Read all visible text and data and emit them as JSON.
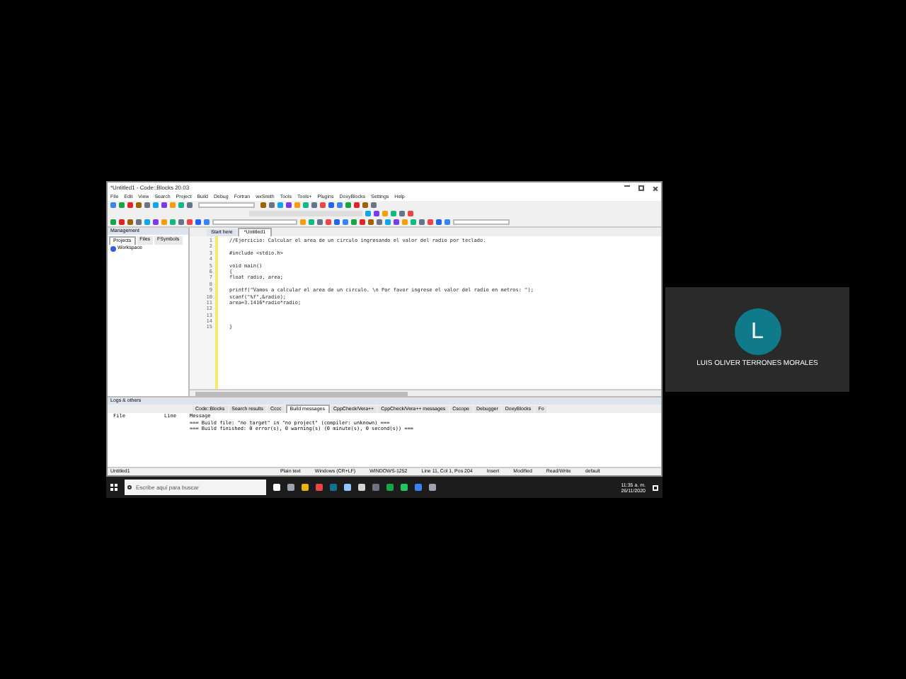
{
  "window": {
    "title": "*Untitled1 - Code::Blocks 20.03"
  },
  "menu": [
    "File",
    "Edit",
    "View",
    "Search",
    "Project",
    "Build",
    "Debug",
    "Fortran",
    "wxSmith",
    "Tools",
    "Tools+",
    "Plugins",
    "DoxyBlocks",
    "Settings",
    "Help"
  ],
  "management": {
    "title": "Management",
    "tabs": [
      {
        "label": "Projects",
        "selected": true
      },
      {
        "label": "Files",
        "selected": false
      },
      {
        "label": "FSymbols",
        "selected": false
      }
    ],
    "items": [
      "Workspace"
    ]
  },
  "editor_tabs": [
    {
      "label": "Start here",
      "selected": false
    },
    {
      "label": "*Untitled1",
      "selected": true
    }
  ],
  "code_lines": [
    {
      "number": "1",
      "text": "//Ejercicio: Calcular el area de un circulo ingresando el valor del radio por teclado."
    },
    {
      "number": "2"
    },
    {
      "number": "3",
      "text": "#include <stdio.h>"
    },
    {
      "number": "4"
    },
    {
      "number": "5",
      "text": "void main()"
    },
    {
      "number": "6",
      "text": "{"
    },
    {
      "number": "7",
      "text": "float radio, area;"
    },
    {
      "number": "8"
    },
    {
      "number": "9",
      "text": "printf(\"Vamos a calcular el area de un circulo. \\n Por favor ingrese el valor del radio en metros: \");"
    },
    {
      "number": "10",
      "text": "scanf(\"%f\",&radio);"
    },
    {
      "number": "11",
      "text": "area=3.1416*radio*radio;"
    },
    {
      "number": "12"
    },
    {
      "number": "13"
    },
    {
      "number": "14"
    },
    {
      "number": "15",
      "text": "}"
    }
  ],
  "logs": {
    "title": "Logs & others",
    "tabs": [
      {
        "label": "Code::Blocks",
        "selected": false
      },
      {
        "label": "Search results",
        "selected": false
      },
      {
        "label": "Cccc",
        "selected": false
      },
      {
        "label": "Build messages",
        "selected": true
      },
      {
        "label": "CppCheck/Vera++",
        "selected": false
      },
      {
        "label": "CppCheck/Vera++ messages",
        "selected": false
      },
      {
        "label": "Cscope",
        "selected": false
      },
      {
        "label": "Debugger",
        "selected": false
      },
      {
        "label": "DoxyBlocks",
        "selected": false
      },
      {
        "label": "Fo",
        "selected": false
      }
    ],
    "columns": [
      "File",
      "Line",
      "Message"
    ],
    "messages": [
      "=== Build file: \"no target\" in \"no project\" (compiler: unknown) ===",
      "=== Build finished: 0 error(s), 0 warning(s) (0 minute(s), 0 second(s)) ==="
    ]
  },
  "status_bar": [
    "Untitled1",
    "Plain text",
    "Windows (CR+LF)",
    "WINDOWS-1252",
    "Line 11, Col 1, Pos 204",
    "Insert",
    "Modified",
    "Read/Write",
    "default"
  ],
  "taskbar": {
    "search_placeholder": "Escribe aquí para buscar",
    "time": "11:35 a. m.",
    "date": "26/11/2020"
  },
  "participant": {
    "initial": "L",
    "name": "LUIS OLIVER TERRONES MORALES"
  }
}
